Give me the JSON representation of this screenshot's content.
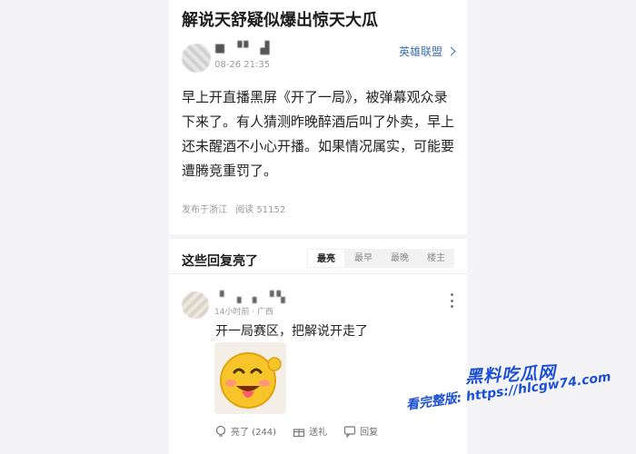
{
  "post": {
    "title": "解说天舒疑似爆出惊天大瓜",
    "author_name": "■ ▝▘ ▟",
    "time": "08-26 21:35",
    "tag": "英雄联盟",
    "body": "早上开直播黑屏《开了一局》，被弹幕观众录下来了。有人猜测昨晚醉酒后叫了外卖，早上还未醒酒不小心开播。如果情况属实，可能要遭腾竞重罚了。",
    "location": "发布于浙江",
    "reads": "阅读 51152"
  },
  "comments": {
    "header": "这些回复亮了",
    "sort_tabs": [
      "最亮",
      "最早",
      "最晚",
      "楼主"
    ],
    "active_tab": 0,
    "items": [
      {
        "user": "▘ ▖▗ ▝▚",
        "meta": "14小时前 · 广西",
        "text": "开一局赛区，把解说开走了",
        "sticker": "laughing-emoji-sticker",
        "actions": {
          "like": "亮了 (244)",
          "gift": "送礼",
          "reply": "回复"
        }
      }
    ]
  },
  "watermark": {
    "title": "黑料吃瓜网",
    "url": "看完整版: https://hlcgw74.com"
  },
  "colors": {
    "link": "#3a6fb0",
    "watermark": "#1b4fd8",
    "background": "#f4f4f6"
  }
}
